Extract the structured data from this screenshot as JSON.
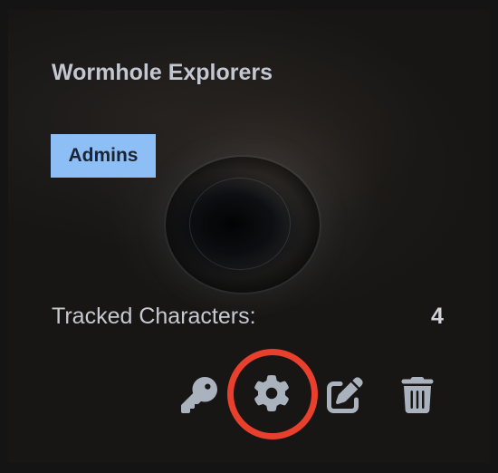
{
  "team": {
    "name": "Wormhole Explorers",
    "role_badge": "Admins",
    "tracked_label": "Tracked Characters:",
    "tracked_count": "4"
  },
  "actions": [
    {
      "icon": "key-icon"
    },
    {
      "icon": "gear-icon"
    },
    {
      "icon": "edit-icon"
    },
    {
      "icon": "trash-icon"
    }
  ],
  "colors": {
    "badge_bg": "#8dbef5",
    "icon": "#aab2be",
    "highlight": "#e8402c",
    "title": "#c3c7d2"
  }
}
